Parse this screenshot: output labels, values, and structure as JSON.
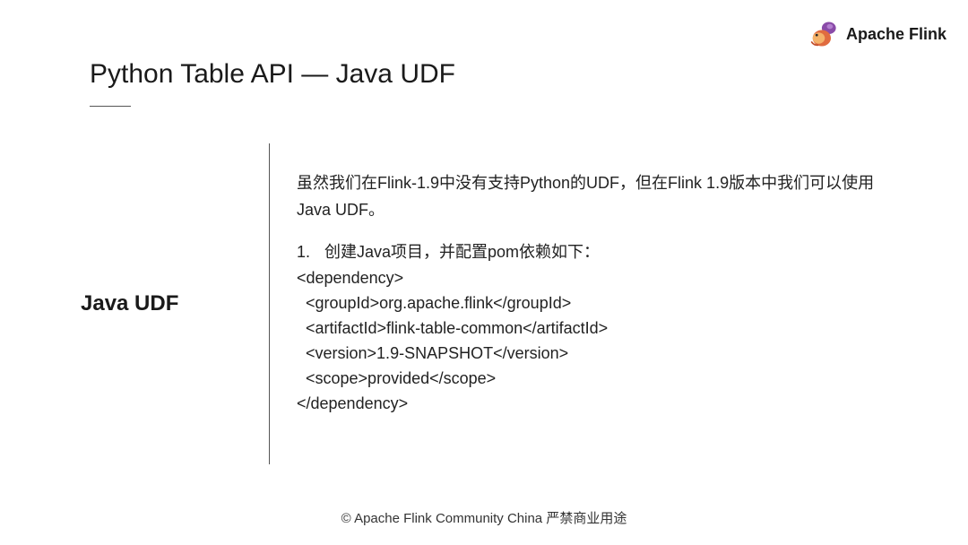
{
  "branding": {
    "name": "Apache Flink"
  },
  "slide": {
    "title": "Python Table API — Java UDF",
    "sidebar_label": "Java UDF",
    "intro_text": "虽然我们在Flink-1.9中没有支持Python的UDF，但在Flink 1.9版本中我们可以使用Java UDF。",
    "step_number": "1.",
    "step_text": "创建Java项目，并配置pom依赖如下：",
    "pom_dependency": "<dependency>\n  <groupId>org.apache.flink</groupId>\n  <artifactId>flink-table-common</artifactId>\n  <version>1.9-SNAPSHOT</version>\n  <scope>provided</scope>\n</dependency>"
  },
  "footer": {
    "text": "© Apache Flink Community China  严禁商业用途"
  }
}
